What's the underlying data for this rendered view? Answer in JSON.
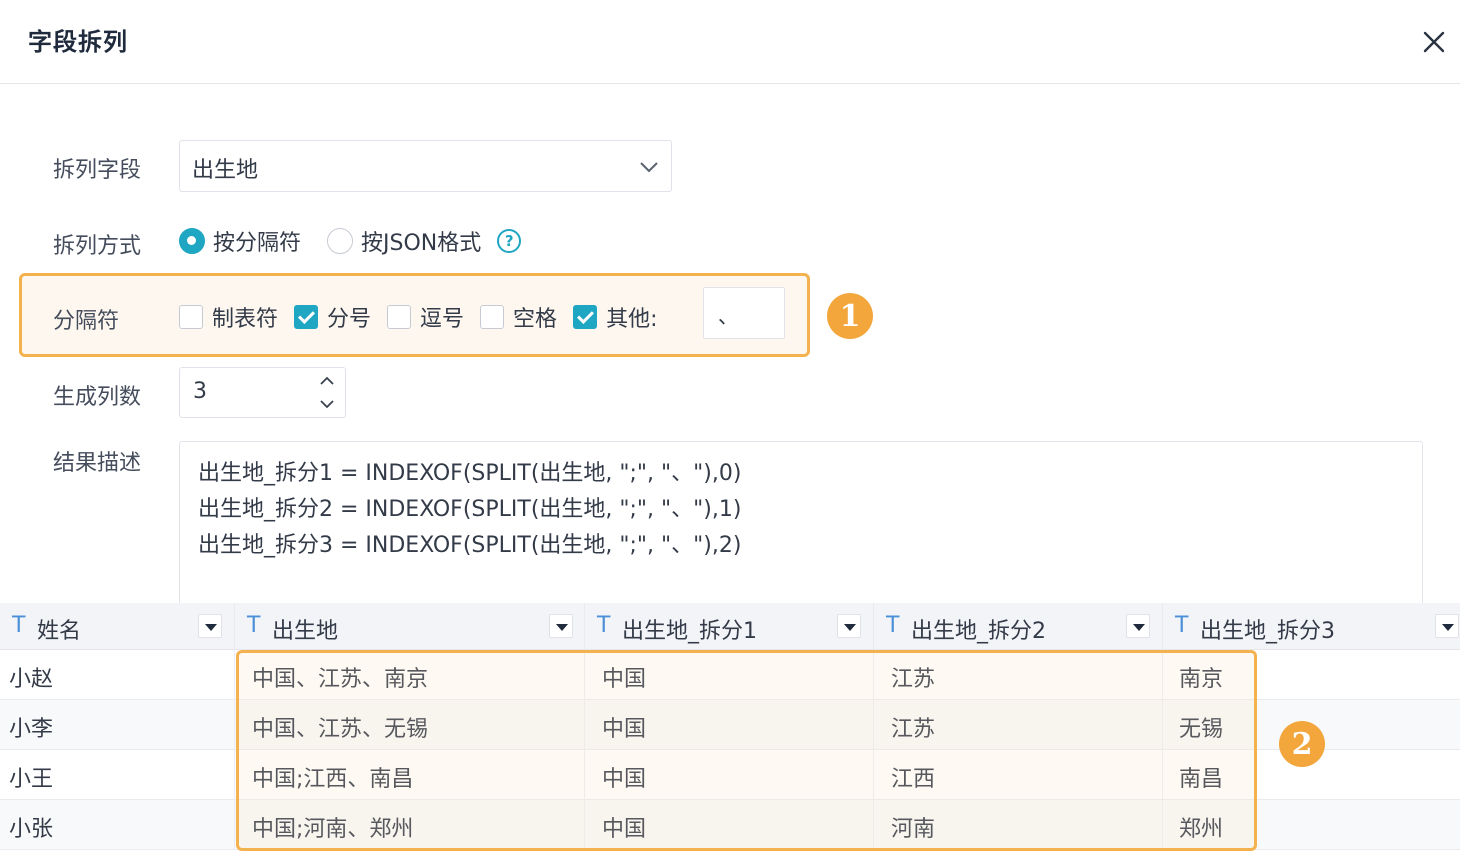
{
  "dialog": {
    "title": "字段拆列"
  },
  "form": {
    "split_field_label": "拆列字段",
    "split_field_value": "出生地",
    "split_method_label": "拆列方式",
    "method_delimiter": "按分隔符",
    "method_json": "按JSON格式",
    "help_icon": "?",
    "delimiter_label": "分隔符",
    "delimiters": [
      {
        "label": "制表符",
        "checked": false
      },
      {
        "label": "分号",
        "checked": true
      },
      {
        "label": "逗号",
        "checked": false
      },
      {
        "label": "空格",
        "checked": false
      },
      {
        "label": "其他:",
        "checked": true
      }
    ],
    "other_value": "、",
    "column_count_label": "生成列数",
    "column_count": "3",
    "result_label": "结果描述",
    "result_lines": [
      "出生地_拆分1 = INDEXOF(SPLIT(出生地, \";\", \"、\"),0)",
      "出生地_拆分2 = INDEXOF(SPLIT(出生地, \";\", \"、\"),1)",
      "出生地_拆分3 = INDEXOF(SPLIT(出生地, \";\", \"、\"),2)"
    ]
  },
  "badges": {
    "one": "1",
    "two": "2"
  },
  "table": {
    "type_icon": "T",
    "columns": [
      "姓名",
      "出生地",
      "出生地_拆分1",
      "出生地_拆分2",
      "出生地_拆分3"
    ],
    "rows": [
      [
        "小赵",
        "中国、江苏、南京",
        "中国",
        "江苏",
        "南京"
      ],
      [
        "小李",
        "中国、江苏、无锡",
        "中国",
        "江苏",
        "无锡"
      ],
      [
        "小王",
        "中国;江西、南昌",
        "中国",
        "江西",
        "南昌"
      ],
      [
        "小张",
        "中国;河南、郑州",
        "中国",
        "河南",
        "郑州"
      ]
    ]
  },
  "colors": {
    "accent": "#1fa6c3",
    "highlight": "#f4b24f",
    "badge": "#f2a63c"
  }
}
